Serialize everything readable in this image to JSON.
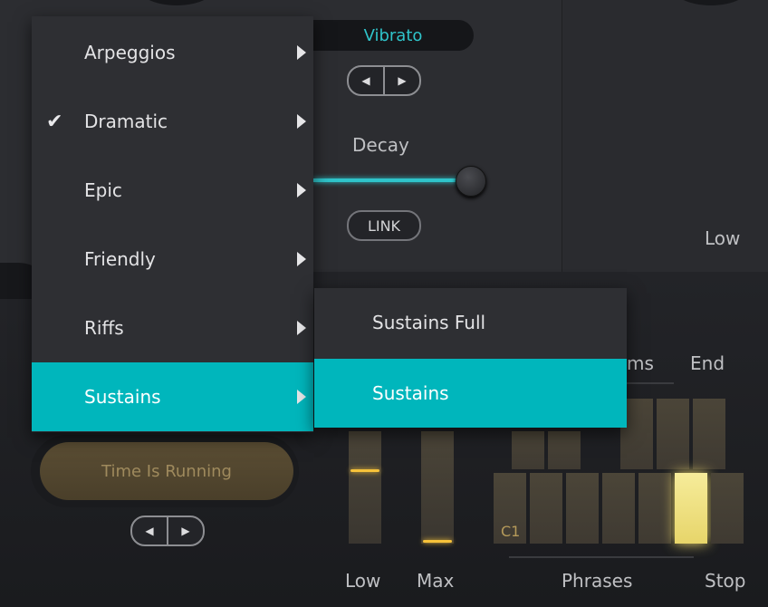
{
  "vibrato": {
    "display": "Vibrato",
    "prev": "◀",
    "next": "▶"
  },
  "decay": {
    "label": "Decay",
    "link": "LINK"
  },
  "labels": {
    "low_top": "Low",
    "ms_partial": "ms",
    "end": "End",
    "low": "Low",
    "max": "Max",
    "phrases": "Phrases",
    "stop": "Stop",
    "key_c1": "C1"
  },
  "time_running": {
    "label": "Time Is Running",
    "prev": "◀",
    "next": "▶"
  },
  "menu": {
    "items": [
      {
        "label": "Arpeggios",
        "checked": false
      },
      {
        "label": "Dramatic",
        "checked": true,
        "check": "✔"
      },
      {
        "label": "Epic",
        "checked": false
      },
      {
        "label": "Friendly",
        "checked": false
      },
      {
        "label": "Riffs",
        "checked": false
      },
      {
        "label": "Sustains",
        "checked": false,
        "active": true
      }
    ]
  },
  "submenu": {
    "items": [
      {
        "label": "Sustains Full"
      },
      {
        "label": "Sustains",
        "active": true
      }
    ]
  },
  "colors": {
    "accent": "#00b6bc",
    "vibrato_text": "#2fc4ca",
    "highlight": "#f6c23a"
  }
}
